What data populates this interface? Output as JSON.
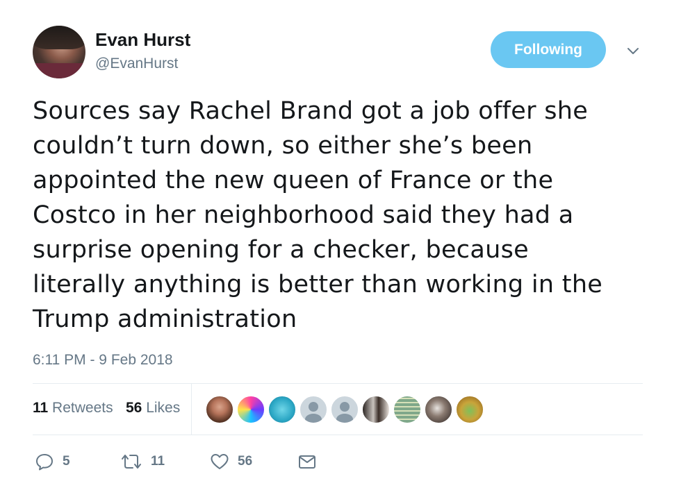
{
  "user": {
    "display_name": "Evan Hurst",
    "handle": "@EvanHurst",
    "avatar_icon": "user-avatar"
  },
  "follow_button": {
    "label": "Following",
    "color": "#6ac7f2"
  },
  "menu_icon": "chevron-down-icon",
  "tweet": {
    "lines": [
      "Sources say Rachel Brand got a job offer she",
      "couldn’t turn down, so either she’s been",
      "appointed the new queen of France or the",
      "Costco in her neighborhood said they had a",
      "surprise opening for a checker, because",
      "literally anything is better than working in the",
      "Trump administration"
    ],
    "timestamp": "6:11 PM - 9 Feb 2018"
  },
  "stats": {
    "retweets": {
      "count": "11",
      "label": "Retweets"
    },
    "likes": {
      "count": "56",
      "label": "Likes"
    }
  },
  "liker_avatars": [
    "liker-avatar-1",
    "liker-avatar-2",
    "liker-avatar-3",
    "liker-avatar-4",
    "liker-avatar-5",
    "liker-avatar-6",
    "liker-avatar-7",
    "liker-avatar-8",
    "liker-avatar-9"
  ],
  "actions": {
    "reply": {
      "icon": "reply-icon",
      "count": "5"
    },
    "retweet": {
      "icon": "retweet-icon",
      "count": "11"
    },
    "like": {
      "icon": "heart-icon",
      "count": "56"
    },
    "message": {
      "icon": "envelope-icon"
    }
  },
  "colors": {
    "text": "#14171a",
    "secondary": "#657786",
    "divider": "#e6ecf0"
  }
}
